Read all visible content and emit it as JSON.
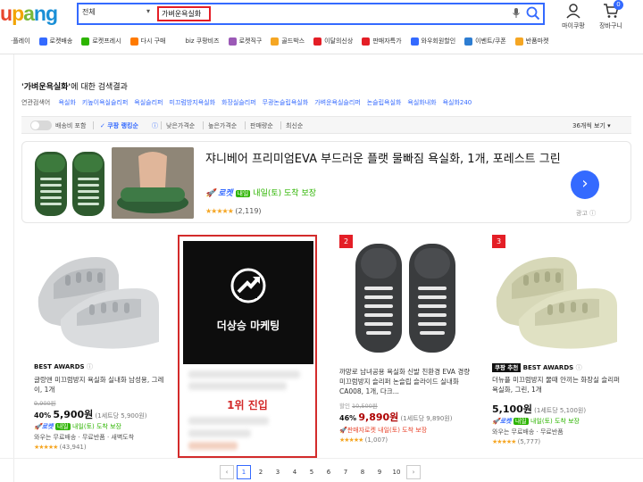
{
  "header": {
    "logo": {
      "p1": "u",
      "p2": "p",
      "p3": "a",
      "p4": "ng"
    },
    "category_select": "전체",
    "search_value": "가벼운욕실화",
    "my_coupang": "마이쿠팡",
    "cart": "장바구니",
    "cart_count": "0"
  },
  "catnav": [
    {
      "label": "·플레이",
      "color": "#ffffff"
    },
    {
      "label": "로켓배송",
      "color": "#346aff"
    },
    {
      "label": "로켓프레시",
      "color": "#2db400"
    },
    {
      "label": "다시 구매",
      "color": "#ff7a00"
    },
    {
      "label": "biz 쿠팡비즈",
      "color": "#ffffff"
    },
    {
      "label": "로켓직구",
      "color": "#9b59b6"
    },
    {
      "label": "골드박스",
      "color": "#f5a623"
    },
    {
      "label": "이달의신상",
      "color": "#e41e26"
    },
    {
      "label": "판매자특가",
      "color": "#e41e26"
    },
    {
      "label": "와우회원할인",
      "color": "#346aff"
    },
    {
      "label": "이벤트/쿠폰",
      "color": "#2d7dd2"
    },
    {
      "label": "반품마켓",
      "color": "#f5a623"
    }
  ],
  "results": {
    "query": "'가벼운욕실화'",
    "suffix": "에 대한 검색결과",
    "related_label": "연관검색어",
    "related": [
      "욕실화",
      "키높이욕실슬리퍼",
      "욕실슬리퍼",
      "미끄럼방지욕실화",
      "화장실슬리퍼",
      "무광논슬립욕실화",
      "가벼운욕실슬리퍼",
      "논슬립욕실화",
      "욕실화내화",
      "욕실화240"
    ]
  },
  "filters": {
    "free_shipping": "배송비 포함",
    "rank": "✓ 쿠팡 랭킹순",
    "low_price": "낮은가격순",
    "high_price": "높은가격순",
    "sales": "판매량순",
    "latest": "최신순",
    "per_page": "36개씩 보기"
  },
  "ad": {
    "title": "쟈니베어 프리미엄EVA 부드러운 플랫 물빠짐 욕실화, 1개, 포레스트 그린",
    "rocket": "로켓",
    "naeil": "내일",
    "delivery": "내일(토) 도착 보장",
    "stars": "★★★★★",
    "reviews": "(2,119)",
    "label": "광고",
    "next": "›"
  },
  "products": [
    {
      "best": "BEST AWARDS",
      "name": "글랑앤 미끄럼방지 욕실화 실내화 남성용, 그레이, 1개",
      "orig": "9,900원",
      "discount": "40%",
      "price": "5,900원",
      "unit": "(1세트당 5,900원)",
      "delivery": "내일(토) 도착 보장",
      "ship": "와우는 무료배송 · 무료반품 · 새벽도착",
      "stars": "★★★★★",
      "reviews": "(43,941)"
    },
    {
      "rank": "2",
      "name": "까망로 남녀공용 욕실화 신발 친환경 EVA 경량 미끄럼방지 슬리퍼 논슬립 슬라이드 실내화 CA008, 1개, 다크...",
      "orig_label": "할인",
      "orig": "10,500원",
      "discount": "46%",
      "price": "9,890원",
      "unit": "(1세트당 9,890원)",
      "delivery": "판매자로켓 내일(토) 도착 보장",
      "stars": "★★★★★",
      "reviews": "(1,007)"
    },
    {
      "rank": "3",
      "tag": "쿠팡 추천",
      "best": "BEST AWARDS",
      "name": "더뉴플 미끄럼방지 물때 안끼는 화장실 슬리퍼 욕실화, 그린, 1개",
      "price": "5,100원",
      "unit": "(1세트당 5,100원)",
      "delivery": "내일(토) 도착 보장",
      "ship": "와우는 무료배송 · 무료반품",
      "stars": "★★★★★",
      "reviews": "(5,777)"
    }
  ],
  "marketing": {
    "brand": "더상승 마케팅",
    "caption": "1위 진입"
  },
  "pagination": {
    "prev": "‹",
    "pages": [
      "1",
      "2",
      "3",
      "4",
      "5",
      "6",
      "7",
      "8",
      "9",
      "10"
    ],
    "next": "›"
  },
  "colors": {
    "accent": "#346aff",
    "price_red": "#ae0000",
    "highlight_red": "#d32b2b",
    "rocket_green": "#2db400"
  }
}
